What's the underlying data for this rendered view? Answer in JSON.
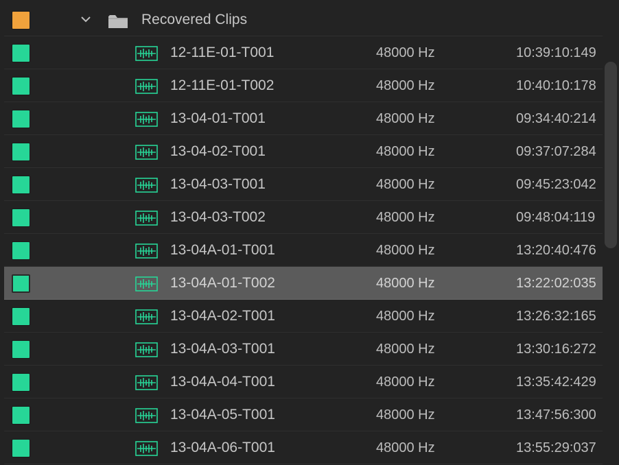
{
  "folder": {
    "name": "Recovered Clips",
    "color": "#f0a23c",
    "expanded": true
  },
  "clip_color": "#27d697",
  "selected_index": 7,
  "clips": [
    {
      "name": "12-11E-01-T001",
      "rate": "48000 Hz",
      "timecode": "10:39:10:149"
    },
    {
      "name": "12-11E-01-T002",
      "rate": "48000 Hz",
      "timecode": "10:40:10:178"
    },
    {
      "name": "13-04-01-T001",
      "rate": "48000 Hz",
      "timecode": "09:34:40:214"
    },
    {
      "name": "13-04-02-T001",
      "rate": "48000 Hz",
      "timecode": "09:37:07:284"
    },
    {
      "name": "13-04-03-T001",
      "rate": "48000 Hz",
      "timecode": "09:45:23:042"
    },
    {
      "name": "13-04-03-T002",
      "rate": "48000 Hz",
      "timecode": "09:48:04:119"
    },
    {
      "name": "13-04A-01-T001",
      "rate": "48000 Hz",
      "timecode": "13:20:40:476"
    },
    {
      "name": "13-04A-01-T002",
      "rate": "48000 Hz",
      "timecode": "13:22:02:035"
    },
    {
      "name": "13-04A-02-T001",
      "rate": "48000 Hz",
      "timecode": "13:26:32:165"
    },
    {
      "name": "13-04A-03-T001",
      "rate": "48000 Hz",
      "timecode": "13:30:16:272"
    },
    {
      "name": "13-04A-04-T001",
      "rate": "48000 Hz",
      "timecode": "13:35:42:429"
    },
    {
      "name": "13-04A-05-T001",
      "rate": "48000 Hz",
      "timecode": "13:47:56:300"
    },
    {
      "name": "13-04A-06-T001",
      "rate": "48000 Hz",
      "timecode": "13:55:29:037"
    }
  ]
}
